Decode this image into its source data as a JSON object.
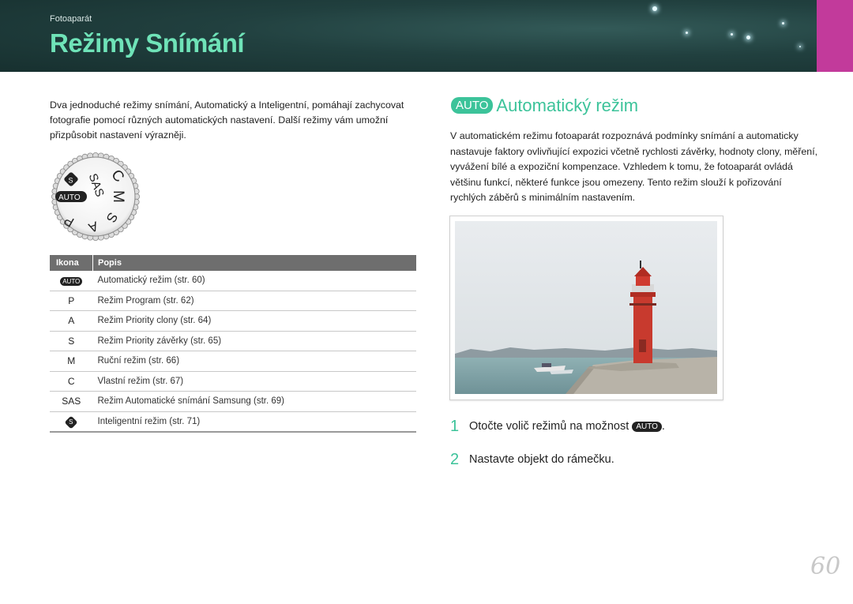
{
  "header": {
    "section": "Fotoaparát",
    "title": "Režimy Snímání"
  },
  "intro": "Dva jednoduché režimy snímání, Automatický a Inteligentní, pomáhají zachycovat fotografie pomocí různých automatických nastavení. Další režimy vám umožní přizpůsobit nastavení výrazněji.",
  "dial": {
    "labels": [
      "SAS",
      "C",
      "M",
      "S",
      "A",
      "P",
      "AUTO"
    ],
    "smart_icon": "smart-auto-icon"
  },
  "table": {
    "headers": [
      "Ikona",
      "Popis"
    ],
    "rows": [
      {
        "icon": "AUTO",
        "desc": "Automatický režim (str. 60)"
      },
      {
        "icon": "P",
        "desc": "Režim Program (str. 62)"
      },
      {
        "icon": "A",
        "desc": "Režim Priority clony (str. 64)"
      },
      {
        "icon": "S",
        "desc": "Režim Priority závěrky (str. 65)"
      },
      {
        "icon": "M",
        "desc": "Ruční režim (str. 66)"
      },
      {
        "icon": "C",
        "desc": "Vlastní režim (str. 67)"
      },
      {
        "icon": "SAS",
        "desc": "Režim Automatické snímání Samsung (str. 69)"
      },
      {
        "icon": "S",
        "desc": "Inteligentní režim (str. 71)"
      }
    ]
  },
  "auto_section": {
    "badge": "AUTO",
    "title": "Automatický režim",
    "body": "V automatickém režimu fotoaparát rozpoznává podmínky snímání a automaticky nastavuje faktory ovlivňující expozici včetně rychlosti závěrky, hodnoty clony, měření, vyvážení bílé a expoziční kompenzace. Vzhledem k tomu, že fotoaparát ovládá většinu funkcí, některé funkce jsou omezeny. Tento režim slouží k pořizování rychlých záběrů s minimálním nastavením."
  },
  "steps": [
    {
      "num": "1",
      "text": "Otočte volič režimů na možnost",
      "badge": "AUTO",
      "suffix": "."
    },
    {
      "num": "2",
      "text": "Nastavte objekt do rámečku."
    }
  ],
  "page_number": "60",
  "colors": {
    "accent_green": "#3cc39a",
    "title_green": "#6fe3b8",
    "banner": "#21403f",
    "magenta": "#c23a9b"
  }
}
